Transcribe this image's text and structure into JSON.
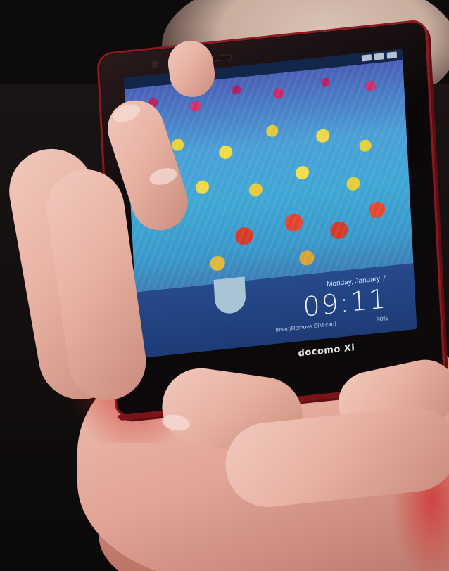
{
  "phone": {
    "brand_label": "docomo Xi",
    "lockscreen": {
      "date": "Monday, January 7",
      "time": "09:11",
      "sim_status": "Insert/Remove SIM card",
      "battery": "98%"
    }
  },
  "colors": {
    "phone_frame": "#8a1a1f",
    "screen_panel": "#1d3b76",
    "skin": "#e8b2a3",
    "background": "#0e0b0b"
  },
  "icons": [
    "signal-icon",
    "wifi-icon",
    "battery-icon",
    "unlock-handle-icon"
  ]
}
